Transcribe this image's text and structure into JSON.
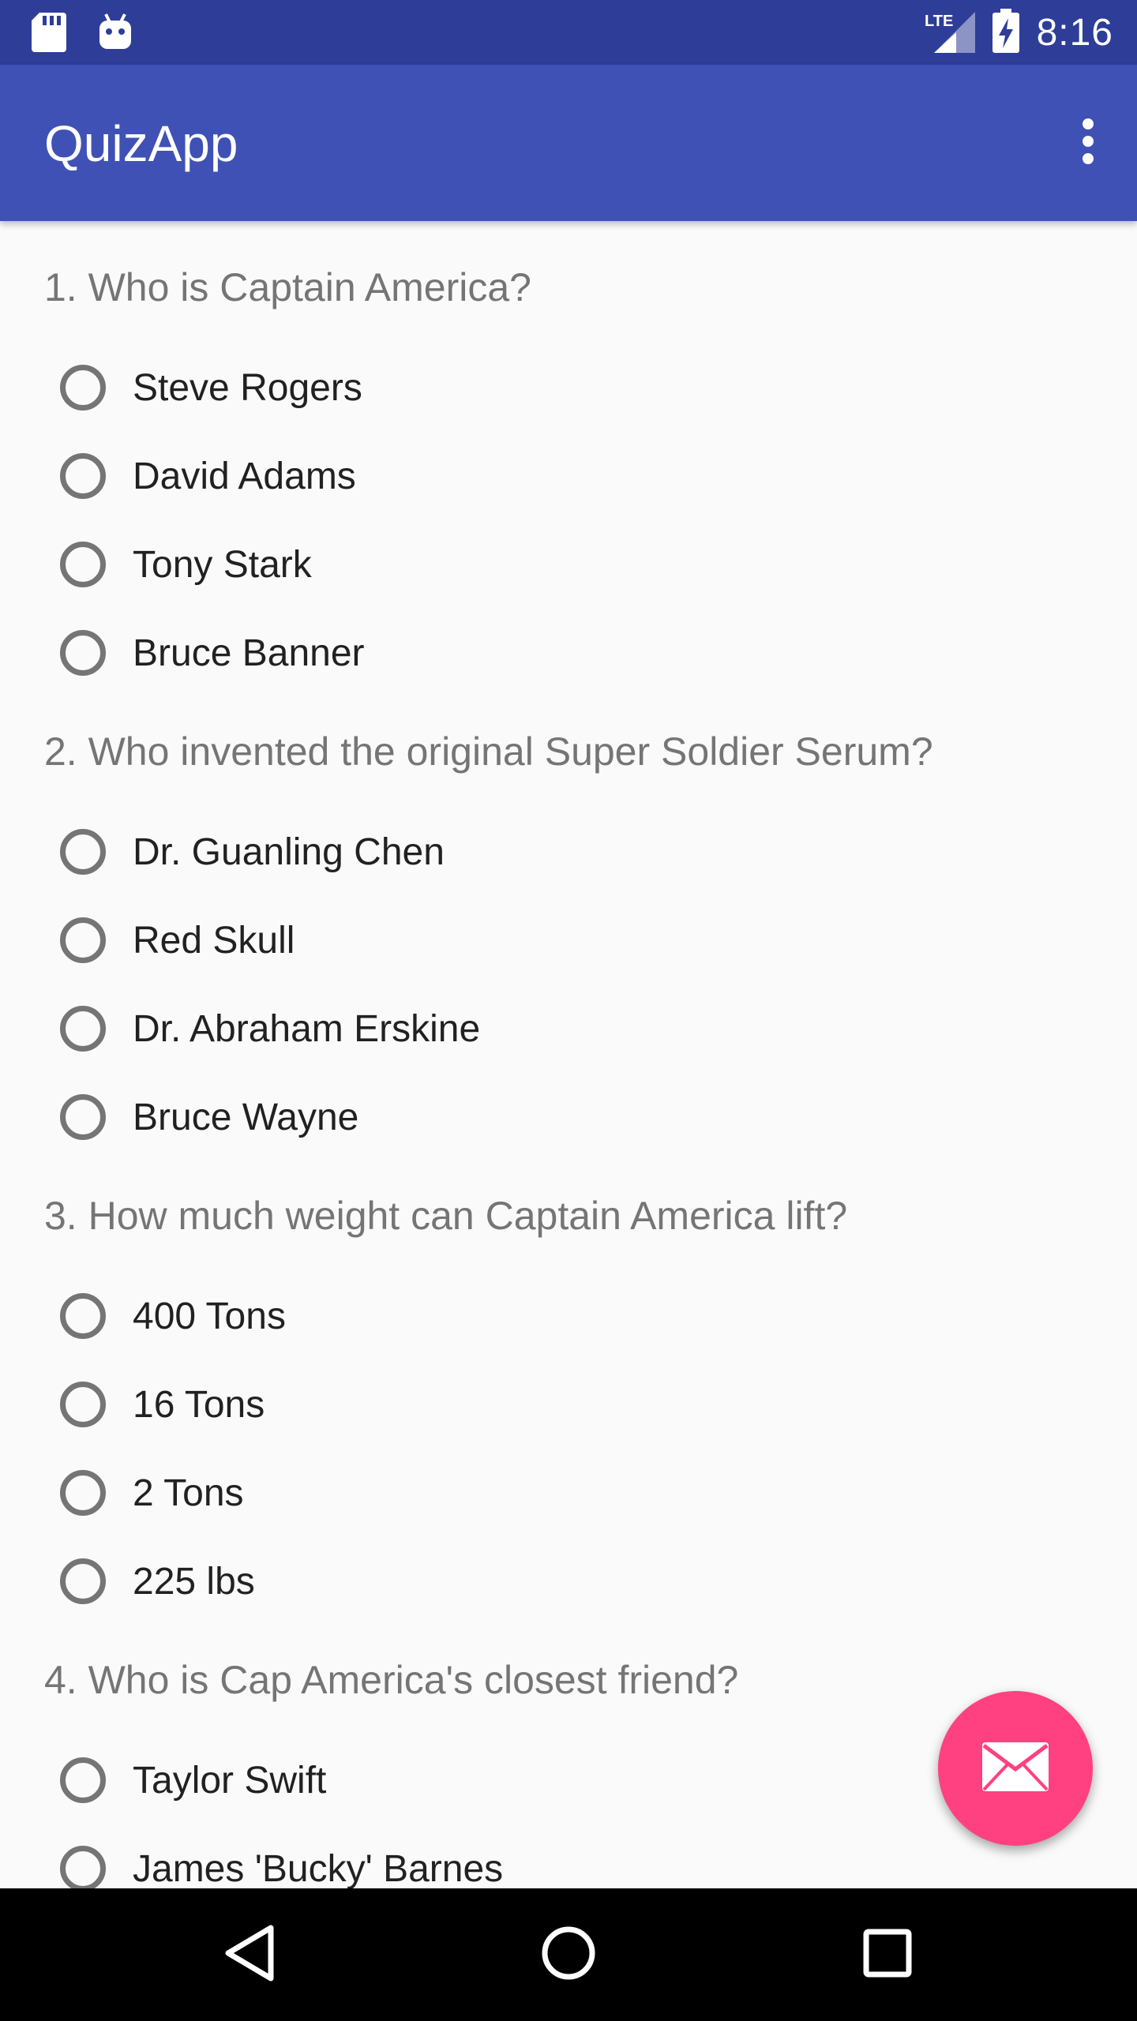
{
  "status_bar": {
    "time": "8:16",
    "network": "LTE",
    "icons": [
      "sd-card-icon",
      "android-icon",
      "lte-signal-icon",
      "battery-charging-icon"
    ]
  },
  "app_bar": {
    "title": "QuizApp",
    "overflow_icon": "more-vert-icon"
  },
  "quiz": {
    "questions": [
      {
        "text": "1. Who is Captain America?",
        "options": [
          "Steve Rogers",
          "David Adams",
          "Tony Stark",
          "Bruce Banner"
        ]
      },
      {
        "text": "2. Who invented the original Super Soldier Serum?",
        "options": [
          "Dr. Guanling Chen",
          "Red Skull",
          "Dr. Abraham Erskine",
          "Bruce Wayne"
        ]
      },
      {
        "text": "3. How much weight can Captain America lift?",
        "options": [
          "400 Tons",
          "16 Tons",
          "2 Tons",
          "225 lbs"
        ]
      },
      {
        "text": "4. Who is Cap America's closest friend?",
        "options": [
          "Taylor Swift",
          "James 'Bucky' Barnes"
        ]
      }
    ]
  },
  "fab": {
    "icon": "email-icon"
  },
  "nav_bar": {
    "icons": [
      "back-icon",
      "home-icon",
      "recents-icon"
    ]
  },
  "colors": {
    "status_bar": "#2e3d98",
    "app_bar": "#3f51b5",
    "fab": "#ff4081",
    "background": "#fafafa",
    "question_text": "#757575",
    "option_text": "#212121"
  }
}
